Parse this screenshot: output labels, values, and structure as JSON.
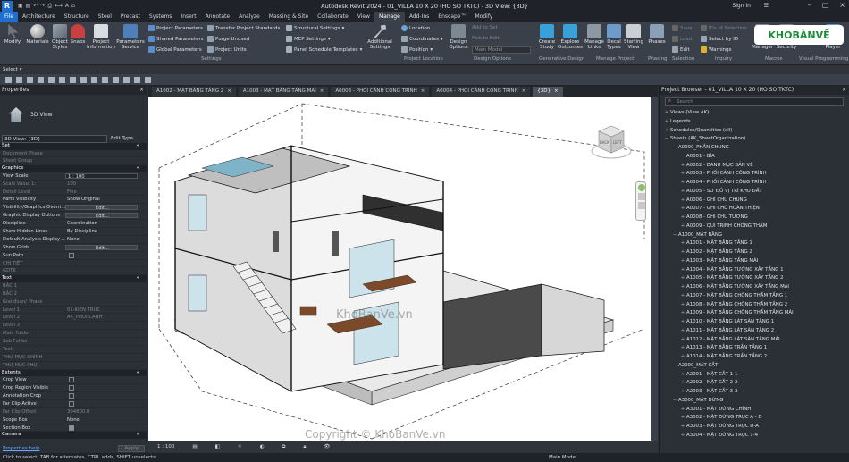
{
  "app": {
    "badge": "R",
    "caption": "Autodesk Revit 2024 - 01_VILLA 10 X 20 (HO SO TKTC) - 3D View: {3D}",
    "sign_in": "Sign In",
    "account": "☰"
  },
  "ribbon_tabs": [
    "File",
    "Architecture",
    "Structure",
    "Steel",
    "Precast",
    "Systems",
    "Insert",
    "Annotate",
    "Analyze",
    "Massing & Site",
    "Collaborate",
    "View",
    "Manage",
    "Add-Ins",
    "Enscape™",
    "Modify"
  ],
  "ribbon": {
    "modify": "Modify",
    "materials": "Materials",
    "object_styles": "Object Styles",
    "snaps": "Snaps",
    "project_information": "Project Information",
    "parameters_service": "Parameters Service",
    "project_parameters": "Project Parameters",
    "shared_parameters": "Shared Parameters",
    "global_parameters": "Global Parameters",
    "transfer_standards": "Transfer Project Standards",
    "purge_unused": "Purge Unused",
    "project_units": "Project Units",
    "structural_settings": "Structural Settings",
    "mep_settings": "MEP Settings",
    "panel_schedule_templates": "Panel Schedule Templates",
    "additional_settings": "Additional Settings",
    "location": "Location",
    "coordinates": "Coordinates",
    "position": "Position",
    "design_options": "Design Options",
    "add_to_set": "Add to Set",
    "pick_to_edit": "Pick to Edit",
    "main_model": "Main Model",
    "create_study": "Create Study",
    "explore_outcomes": "Explore Outcomes",
    "manage_links": "Manage Links",
    "decal_types": "Decal Types",
    "starting_view": "Starting View",
    "phases": "Phases",
    "save": "Save",
    "load": "Load",
    "edit": "Edit",
    "ids_of_selection": "IDs of Selection",
    "select_by_id": "Select by ID",
    "warnings": "Warnings",
    "macro_manager": "Macro Manager",
    "macro_security": "Macro Security",
    "dynamo_player": "Dynamo Player"
  },
  "panels": [
    "Select ▾",
    "Settings",
    "Project Location",
    "Design Options",
    "Generative Design",
    "Manage Project",
    "Phasing",
    "Selection",
    "Inquiry",
    "Macros",
    "Visual Programming"
  ],
  "properties": {
    "title": "Properties",
    "close": "×",
    "type_name": "3D View",
    "selector": "3D View: {3D}",
    "edit_type": "Edit Type",
    "sections": {
      "set": "Set",
      "graphics": "Graphics",
      "text": "Text",
      "extents": "Extents",
      "camera": "Camera"
    },
    "set_rows": [
      [
        "Document Phase",
        ""
      ],
      [
        "Sheet Group",
        ""
      ]
    ],
    "graphics_rows": [
      [
        "View Scale",
        "1 : 100"
      ],
      [
        "Scale Value 1:",
        "100"
      ],
      [
        "Detail Level",
        "Fine"
      ],
      [
        "Parts Visibility",
        "Show Original"
      ],
      [
        "Visibility/Graphics Overri...",
        "Edit..."
      ],
      [
        "Graphic Display Options",
        "Edit..."
      ],
      [
        "Discipline",
        "Coordination"
      ],
      [
        "Show Hidden Lines",
        "By Discipline"
      ],
      [
        "Default Analysis Display ...",
        "None"
      ],
      [
        "Show Grids",
        "Edit..."
      ],
      [
        "Sun Path",
        ""
      ],
      [
        "CHI TIẾT",
        ""
      ],
      [
        "GDTK",
        ""
      ]
    ],
    "text_rows": [
      [
        "BẬC 1",
        ""
      ],
      [
        "BẬC 2",
        ""
      ],
      [
        "Giai đoạn/ Phase",
        ""
      ],
      [
        "Level 1",
        "01-KIẾN TRÚC"
      ],
      [
        "Level 2",
        "AK_PHOI CANH"
      ],
      [
        "Level 3",
        ""
      ],
      [
        "Main Folder",
        ""
      ],
      [
        "Sub Folder",
        ""
      ],
      [
        "Text",
        ""
      ],
      [
        "THƯ MỤC CHÍNH",
        ""
      ],
      [
        "THƯ MỤC PHỤ",
        ""
      ]
    ],
    "extents_rows": [
      [
        "Crop View",
        ""
      ],
      [
        "Crop Region Visible",
        ""
      ],
      [
        "Annotation Crop",
        ""
      ],
      [
        "Far Clip Active",
        ""
      ],
      [
        "Far Clip Offset",
        "304800.0"
      ],
      [
        "Scope Box",
        "None"
      ],
      [
        "Section Box",
        ""
      ]
    ],
    "help": "Properties help",
    "apply": "Apply"
  },
  "view_tabs": [
    {
      "label": "A1002 - MẶT BẰNG TẦNG 2",
      "close": "×"
    },
    {
      "label": "A1003 - MẶT BẰNG TẦNG MÁI",
      "close": "×"
    },
    {
      "label": "A0003 - PHỐI CẢNH CÔNG TRÌNH",
      "close": "×"
    },
    {
      "label": "A0004 - PHỐI CẢNH CÔNG TRÌNH",
      "close": "×"
    },
    {
      "label": "{3D}",
      "close": "×"
    }
  ],
  "viewcube": {
    "back": "BACK",
    "left": "LEFT"
  },
  "view_control": {
    "scale": "1 : 100"
  },
  "watermarks": {
    "center": "KhoBanVe.vn",
    "bottom": "Copyright © KhoBanVe.vn",
    "logo": "KHOBÀNVẾ"
  },
  "browser": {
    "title": "Project Browser - 01_VILLA 10 X 20 (HO SO TKTC)",
    "close": "×",
    "search_placeholder": "Search",
    "items": [
      {
        "t": "+",
        "label": "Views (View AK)",
        "lvl": 0
      },
      {
        "t": "+",
        "label": "Legends",
        "lvl": 0
      },
      {
        "t": "+",
        "label": "Schedules/Quantities (all)",
        "lvl": 0
      },
      {
        "t": "−",
        "label": "Sheets (AK_SheetOrganization)",
        "lvl": 0
      },
      {
        "t": "−",
        "label": "A0000_PHẦN CHUNG",
        "lvl": 1
      },
      {
        "t": "",
        "label": "A0001 - BÍA",
        "lvl": 2
      },
      {
        "t": "+",
        "label": "A0002 - DANH MỤC BẢN VẼ",
        "lvl": 2
      },
      {
        "t": "+",
        "label": "A0003 - PHỐI CẢNH CÔNG TRÌNH",
        "lvl": 2
      },
      {
        "t": "+",
        "label": "A0004 - PHỐI CẢNH CÔNG TRÌNH",
        "lvl": 2
      },
      {
        "t": "+",
        "label": "A0005 - SƠ ĐỒ VỊ TRÍ KHU ĐẤT",
        "lvl": 2
      },
      {
        "t": "+",
        "label": "A0006 - GHI CHÚ CHUNG",
        "lvl": 2
      },
      {
        "t": "+",
        "label": "A0007 - GHI CHÚ HOÀN THIỆN",
        "lvl": 2
      },
      {
        "t": "+",
        "label": "A0008 - GHI CHÚ TƯỜNG",
        "lvl": 2
      },
      {
        "t": "+",
        "label": "A0009 - QUI TRÌNH CHỐNG THẤM",
        "lvl": 2
      },
      {
        "t": "−",
        "label": "A1000_MẶT BẰNG",
        "lvl": 1
      },
      {
        "t": "+",
        "label": "A1001 - MẶT BẰNG TẦNG 1",
        "lvl": 2
      },
      {
        "t": "+",
        "label": "A1002 - MẶT BẰNG TẦNG 2",
        "lvl": 2
      },
      {
        "t": "+",
        "label": "A1003 - MẶT BẰNG TẦNG MÁI",
        "lvl": 2
      },
      {
        "t": "+",
        "label": "A1004 - MẶT BẰNG TƯỜNG XÂY TẦNG 1",
        "lvl": 2
      },
      {
        "t": "+",
        "label": "A1005 - MẶT BẰNG TƯỜNG XÂY TẦNG 2",
        "lvl": 2
      },
      {
        "t": "+",
        "label": "A1006 - MẶT BẰNG TƯỜNG XÂY TẦNG MÁI",
        "lvl": 2
      },
      {
        "t": "+",
        "label": "A1007 - MẶT BẰNG CHỐNG THẤM TẦNG 1",
        "lvl": 2
      },
      {
        "t": "+",
        "label": "A1008 - MẶT BẰNG CHỐNG THẤM TẦNG 2",
        "lvl": 2
      },
      {
        "t": "+",
        "label": "A1009 - MẶT BẰNG CHỐNG THẤM TẦNG MÁI",
        "lvl": 2
      },
      {
        "t": "+",
        "label": "A1010 - MẶT BẰNG LÁT SÀN TẦNG 1",
        "lvl": 2
      },
      {
        "t": "+",
        "label": "A1011 - MẶT BẰNG LÁT SÀN TẦNG 2",
        "lvl": 2
      },
      {
        "t": "+",
        "label": "A1012 - MẶT BẰNG LÁT SÀN TẦNG MÁI",
        "lvl": 2
      },
      {
        "t": "+",
        "label": "A1013 - MẶT BẰNG TRẦN TẦNG 1",
        "lvl": 2
      },
      {
        "t": "+",
        "label": "A1014 - MẶT BẰNG TRẦN TẦNG 2",
        "lvl": 2
      },
      {
        "t": "−",
        "label": "A2000_MẶT CẮT",
        "lvl": 1
      },
      {
        "t": "+",
        "label": "A2001 - MẶT CẮT 1-1",
        "lvl": 2
      },
      {
        "t": "+",
        "label": "A2002 - MẶT CẮT 2-2",
        "lvl": 2
      },
      {
        "t": "+",
        "label": "A2003 - MẶT CẮT 3-3",
        "lvl": 2
      },
      {
        "t": "−",
        "label": "A3000_MẶT ĐỨNG",
        "lvl": 1
      },
      {
        "t": "+",
        "label": "A3001 - MẶT ĐỨNG CHÍNH",
        "lvl": 2
      },
      {
        "t": "+",
        "label": "A3002 - MẶT ĐỨNG TRỤC A - D",
        "lvl": 2
      },
      {
        "t": "+",
        "label": "A3003 - MẶT ĐỨNG TRỤC D-A",
        "lvl": 2
      },
      {
        "t": "+",
        "label": "A3004 - MẶT ĐỨNG TRỤC 1-4",
        "lvl": 2
      }
    ]
  },
  "status": {
    "hint": "Click to select, TAB for alternates, CTRL adds, SHIFT unselects.",
    "model": "Main Model"
  }
}
